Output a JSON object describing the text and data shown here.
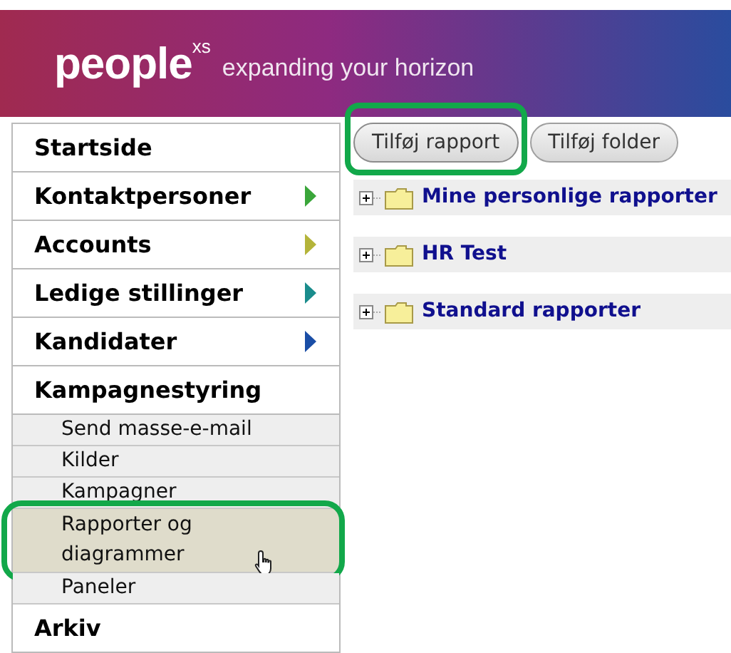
{
  "header": {
    "logo": "people",
    "logo_mark": "xs",
    "tagline": "expanding your horizon"
  },
  "sidebar": {
    "items": [
      {
        "label": "Startside"
      },
      {
        "label": "Kontaktpersoner",
        "color": "#3aa63a"
      },
      {
        "label": "Accounts",
        "color": "#b4b43a"
      },
      {
        "label": "Ledige stillinger",
        "color": "#1a8c8c"
      },
      {
        "label": "Kandidater",
        "color": "#1a4ea6"
      },
      {
        "label": "Kampagnestyring",
        "children": [
          {
            "label": "Send masse-e-mail",
            "selected": false,
            "highlighted": false
          },
          {
            "label": "Kilder",
            "selected": false,
            "highlighted": false
          },
          {
            "label": "Kampagner",
            "selected": false,
            "highlighted": false
          },
          {
            "label": "Rapporter og diagrammer",
            "selected": true,
            "highlighted": true
          },
          {
            "label": "Paneler",
            "selected": false,
            "highlighted": false
          }
        ]
      },
      {
        "label": "Arkiv"
      }
    ]
  },
  "toolbar": {
    "buttons": [
      {
        "label": "Tilføj rapport",
        "highlighted": true
      },
      {
        "label": "Tilføj folder",
        "highlighted": false
      }
    ]
  },
  "tree": [
    {
      "label": "Mine personlige rapporter",
      "expanded": false
    },
    {
      "label": "HR Test",
      "expanded": false
    },
    {
      "label": "Standard rapporter",
      "expanded": false
    }
  ]
}
